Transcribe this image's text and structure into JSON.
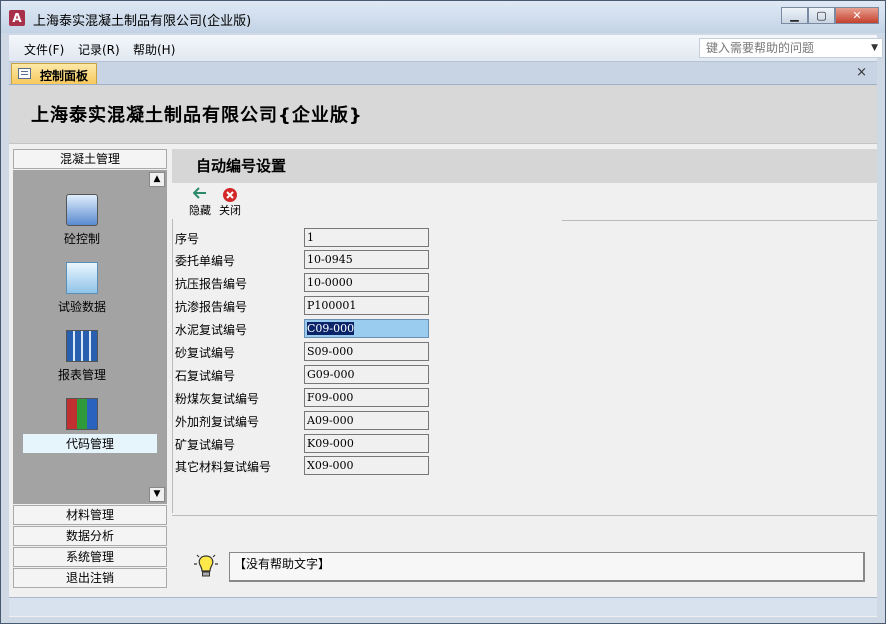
{
  "window": {
    "title": "上海泰实混凝土制品有限公司(企业版)",
    "app_letter": "A"
  },
  "menu": {
    "file": "文件(F)",
    "records": "记录(R)",
    "help": "帮助(H)",
    "help_search_placeholder": "键入需要帮助的问题"
  },
  "tab": {
    "label": "控制面板",
    "close": "×"
  },
  "header": {
    "company": "上海泰实混凝土制品有限公司{企业版}"
  },
  "nav": {
    "active_group": "混凝土管理",
    "items": [
      {
        "label": "砼控制",
        "icon": "browser-window-icon"
      },
      {
        "label": "试验数据",
        "icon": "folder-icon"
      },
      {
        "label": "报表管理",
        "icon": "calendar-grid-icon"
      },
      {
        "label": "代码管理",
        "icon": "books-icon"
      }
    ],
    "groups": [
      "材料管理",
      "数据分析",
      "系统管理",
      "退出注销"
    ]
  },
  "content": {
    "title": "自动编号设置",
    "toolbar": {
      "hide": "隐藏",
      "close": "关闭"
    },
    "fields": [
      {
        "label": "序号",
        "value": "1"
      },
      {
        "label": "委托单编号",
        "value": "10-0945"
      },
      {
        "label": "抗压报告编号",
        "value": "10-0000"
      },
      {
        "label": "抗渗报告编号",
        "value": "P100001"
      },
      {
        "label": "水泥复试编号",
        "value": "C09-000"
      },
      {
        "label": "砂复试编号",
        "value": "S09-000"
      },
      {
        "label": "石复试编号",
        "value": "G09-000"
      },
      {
        "label": "粉煤灰复试编号",
        "value": "F09-000"
      },
      {
        "label": "外加剂复试编号",
        "value": "A09-000"
      },
      {
        "label": "矿复试编号",
        "value": "K09-000"
      },
      {
        "label": "其它材料复试编号",
        "value": "X09-000"
      }
    ]
  },
  "help": {
    "text": "【没有帮助文字】"
  }
}
